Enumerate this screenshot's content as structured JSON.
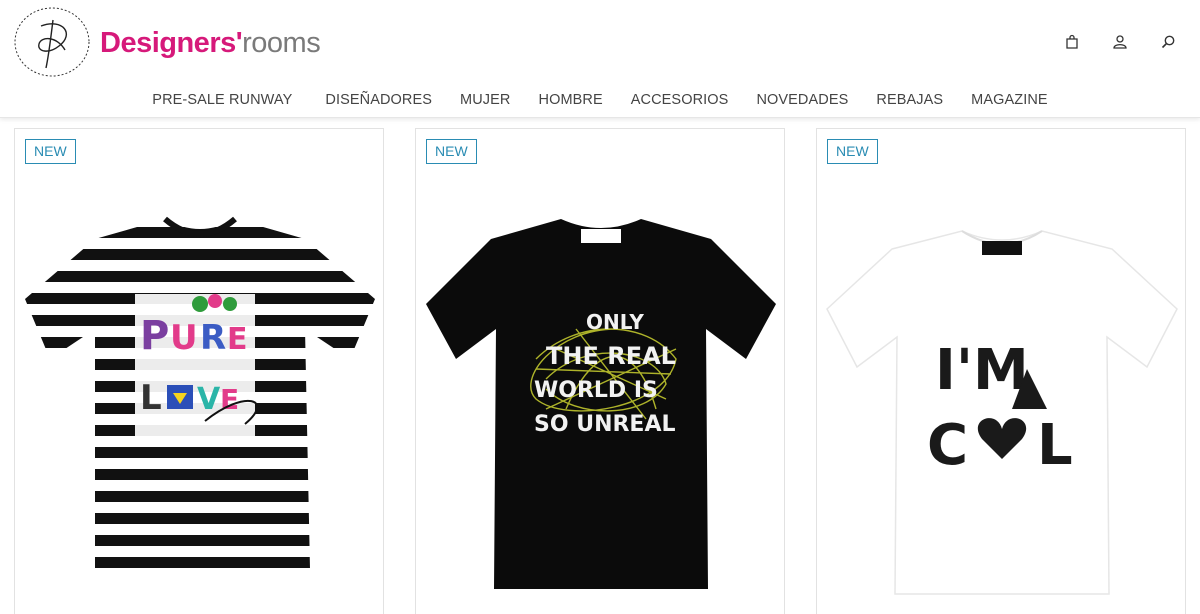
{
  "header": {
    "brand_part1": "Designers'",
    "brand_part2": "rooms",
    "icons": [
      "bag-icon",
      "user-icon",
      "search-icon"
    ]
  },
  "nav": {
    "items": [
      "PRE-SALE RUNWAY",
      "DISEÑADORES",
      "MUJER",
      "HOMBRE",
      "ACCESORIOS",
      "NOVEDADES",
      "REBAJAS",
      "MAGAZINE"
    ]
  },
  "products": [
    {
      "badge": "NEW",
      "print": "PURE LOVE"
    },
    {
      "badge": "NEW",
      "print": "ONLY THE REAL WORLD IS SO UNREAL"
    },
    {
      "badge": "NEW",
      "print": "I'M COOL"
    }
  ],
  "colors": {
    "brand_pink": "#d6197a",
    "badge_blue": "#2a8cb3"
  }
}
